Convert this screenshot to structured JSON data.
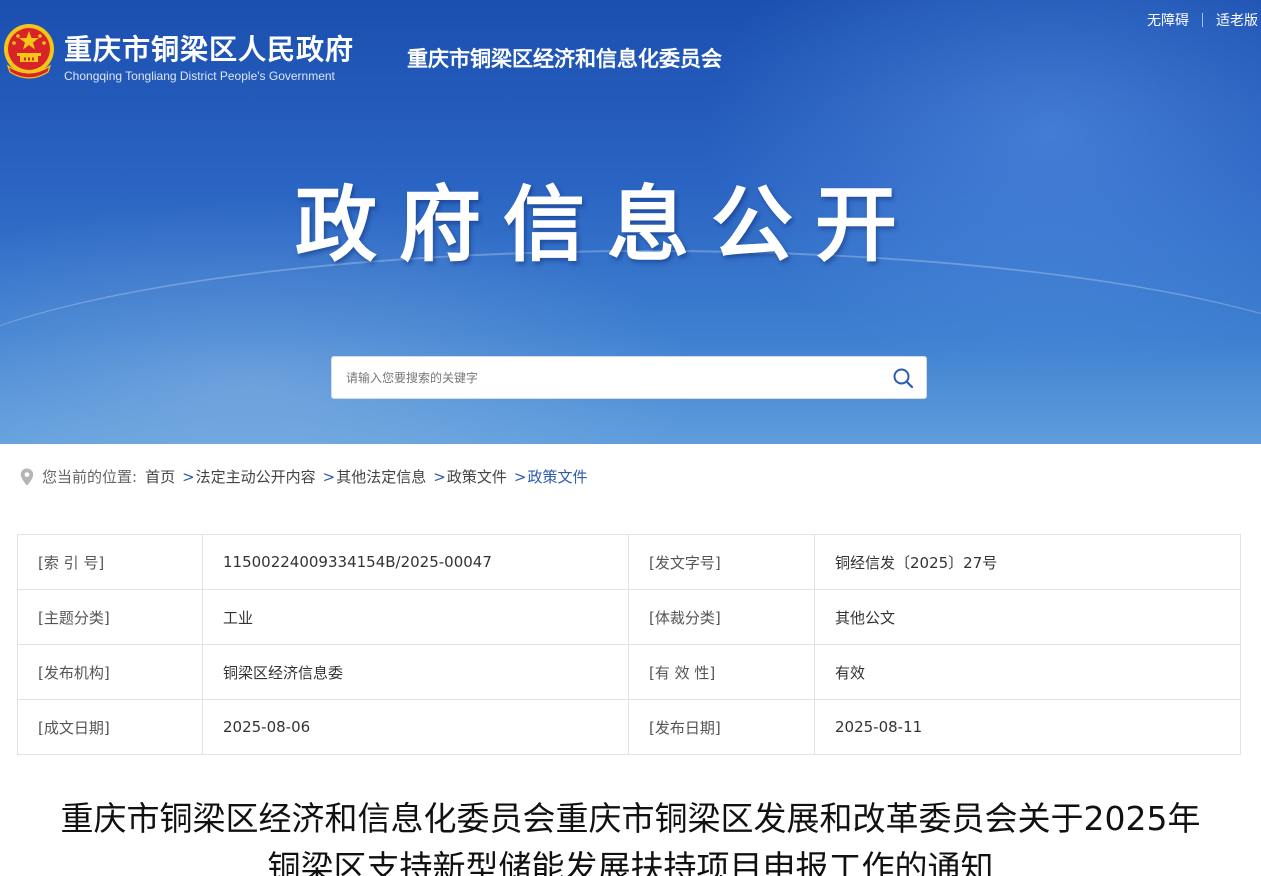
{
  "header": {
    "site_title": "重庆市铜梁区人民政府",
    "site_subtitle": "Chongqing Tongliang District People's Government",
    "dept_title": "重庆市铜梁区经济和信息化委员会",
    "accessibility_link": "无障碍",
    "elderly_link": "适老版"
  },
  "hero": {
    "title": "政府信息公开"
  },
  "search": {
    "placeholder": "请输入您要搜索的关键字",
    "value": ""
  },
  "breadcrumb": {
    "label": "您当前的位置:",
    "items": [
      "首页",
      "法定主动公开内容",
      "其他法定信息",
      "政策文件",
      "政策文件"
    ],
    "separator": ">"
  },
  "meta": {
    "rows": [
      {
        "k1": "[索 引 号]",
        "v1": "11500224009334154B/2025-00047",
        "k2": "[发文字号]",
        "v2": "铜经信发〔2025〕27号"
      },
      {
        "k1": "[主题分类]",
        "v1": "工业",
        "k2": "[体裁分类]",
        "v2": "其他公文"
      },
      {
        "k1": "[发布机构]",
        "v1": "铜梁区经济信息委",
        "k2": "[有 效 性]",
        "v2": "有效"
      },
      {
        "k1": "[成文日期]",
        "v1": "2025-08-06",
        "k2": "[发布日期]",
        "v2": "2025-08-11"
      }
    ]
  },
  "document": {
    "title_line1": "重庆市铜梁区经济和信息化委员会重庆市铜梁区发展和改革委员会关于2025年",
    "title_line2": "铜梁区支持新型储能发展扶持项目申报工作的通知"
  },
  "colors": {
    "banner_top": "#1b4fb0",
    "banner_bottom": "#5f9ddc",
    "link_blue": "#2a5db0",
    "emblem_red": "#d8232a",
    "emblem_gold": "#f5c518"
  },
  "icons": {
    "emblem": "national-emblem-icon",
    "search": "search-icon",
    "location": "location-pin-icon"
  }
}
